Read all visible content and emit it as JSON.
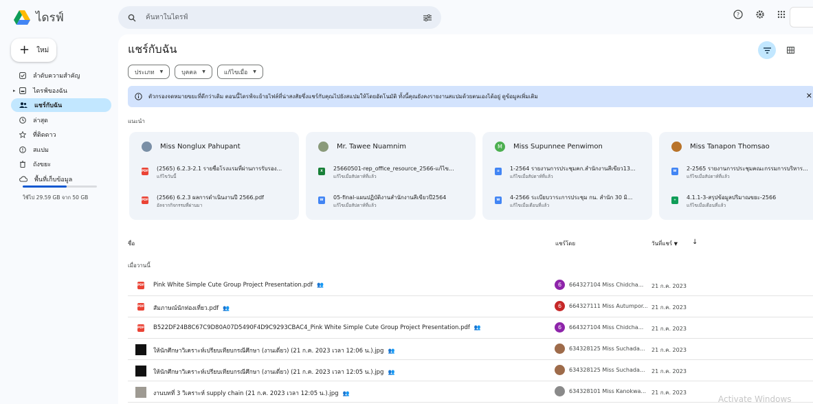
{
  "app": {
    "name": "ไดรฟ์"
  },
  "search": {
    "placeholder": "ค้นหาในไดรฟ์"
  },
  "sidebar": {
    "new_label": "ใหม่",
    "items": [
      {
        "label": "ลำดับความสำคัญ",
        "icon": "priority-icon"
      },
      {
        "label": "ไดรฟ์ของฉัน",
        "icon": "my-drive-icon"
      },
      {
        "label": "แชร์กับฉัน",
        "icon": "shared-icon",
        "active": true
      },
      {
        "label": "ล่าสุด",
        "icon": "clock-icon"
      },
      {
        "label": "ที่ติดดาว",
        "icon": "star-icon"
      },
      {
        "label": "สแปม",
        "icon": "spam-icon"
      },
      {
        "label": "ถังขยะ",
        "icon": "trash-icon"
      },
      {
        "label": "พื้นที่เก็บข้อมูล",
        "icon": "cloud-icon"
      }
    ],
    "storage_text": "ใช้ไป 29.59 GB จาก 50 GB",
    "storage_fraction": 0.59
  },
  "main": {
    "title": "แชร์กับฉัน",
    "filters": [
      "ประเภท",
      "บุคคล",
      "แก้ไขเมื่อ"
    ],
    "banner": "ตัวกรองจดหมายขยะที่ดีกว่าเดิม  ตอนนี้ไดรฟ์จะย้ายไฟล์ที่น่าสงสัยซึ่งแชร์กับคุณไปยังสแปมให้โดยอัตโนมัติ ทั้งนี้คุณยังคงรายงานสแปมด้วยตนเองได้อยู่ ดูข้อมูลเพิ่มเติม",
    "suggested_label": "แนะนำ",
    "cards": [
      {
        "person": "Miss Nonglux Pahupant",
        "avatar_color": "#7a8fa6",
        "files": [
          {
            "title": "(2565) 6.2.3-2.1 รายชื่อโรงแรมที่ผ่านการรับรอง...",
            "sub": "แก้ไขวันนี้",
            "type": "pdf"
          },
          {
            "title": "(2566) 6.2.3 ผลการดำเนินงานปี 2566.pdf",
            "sub": "อัลจากกิจกรรมที่ผ่านมา",
            "type": "pdf"
          }
        ]
      },
      {
        "person": "Mr. Tawee Nuamnim",
        "avatar_color": "#8a9a7a",
        "files": [
          {
            "title": "25660501-rep_office_resource_2566-แก้ไข...",
            "sub": "แก้ไขเมื่อสัปดาห์ที่แล้ว",
            "type": "sheet"
          },
          {
            "title": "05-final-แผนปฏิบัติงานสำนักงานสีเขียวปี2564",
            "sub": "แก้ไขเมื่อสัปดาห์ที่แล้ว",
            "type": "word"
          }
        ]
      },
      {
        "person": "Miss Supunnee Penwimon",
        "avatar_color": "#4caf50",
        "avatar_letter": "M",
        "files": [
          {
            "title": "1-2564 รายงานการประชุมคก.สำนักงานสีเขียว13...",
            "sub": "แก้ไขเมื่อสัปดาห์ที่แล้ว",
            "type": "doc"
          },
          {
            "title": "4-2566 ระเบียบวาระการประชุม กน. สำนัก 30 มิ...",
            "sub": "แก้ไขเมื่อเดือนที่แล้ว",
            "type": "word"
          }
        ]
      },
      {
        "person": "Miss Tanapon Thomsao",
        "avatar_color": "#b8732a",
        "files": [
          {
            "title": "2-2565 รายงานการประชุมคณะกรรมการบริหาร...",
            "sub": "แก้ไขเมื่อสัปดาห์ที่แล้ว",
            "type": "word"
          },
          {
            "title": "4.1.1-3-สรุปข้อมูลปริมาณขยะ-2566",
            "sub": "แก้ไขเมื่อเดือนที่แล้ว",
            "type": "sheet2"
          }
        ]
      }
    ],
    "list": {
      "col_name": "ชื่อ",
      "col_shared_by": "แชร์โดย",
      "col_date": "วันที่แชร์",
      "group_label": "เมื่อวานนี้",
      "rows": [
        {
          "name": "Pink White Simple Cute Group Project Presentation.pdf",
          "kind": "pdf",
          "sharer": "664327104 Miss Chidcha...",
          "sharer_letter": "6",
          "sharer_color": "#8e24aa",
          "date": "21 ก.ค. 2023"
        },
        {
          "name": "สัมภาษณ์นักท่องเที่ยว.pdf",
          "kind": "pdf",
          "sharer": "664327111 Miss Autumpor...",
          "sharer_letter": "6",
          "sharer_color": "#c62828",
          "date": "21 ก.ค. 2023"
        },
        {
          "name": "B522DF24B8C67C9D80A07D5490F4D9C9293CBAC4_Pink White Simple Cute Group Project Presentation.pdf",
          "kind": "pdf",
          "sharer": "664327104 Miss Chidcha...",
          "sharer_letter": "6",
          "sharer_color": "#8e24aa",
          "date": "21 ก.ค. 2023"
        },
        {
          "name": "ให้นักศึกษาวิเคราะห์เปรียบเทียบกรณีศึกษา (งานเดี่ยว) (21 ก.ค. 2023 เวลา 12:06 น.).jpg",
          "kind": "img",
          "sharer": "634328125 Miss Suchada...",
          "sharer_letter": "",
          "sharer_color": "#9e6b4a",
          "date": "21 ก.ค. 2023"
        },
        {
          "name": "ให้นักศึกษาวิเคราะห์เปรียบเทียบกรณีศึกษา (งานเดี่ยว) (21 ก.ค. 2023 เวลา 12:05 น.).jpg",
          "kind": "img",
          "sharer": "634328125 Miss Suchada...",
          "sharer_letter": "",
          "sharer_color": "#9e6b4a",
          "date": "21 ก.ค. 2023"
        },
        {
          "name": "งานบทที่ 3 วิเคราะห์ supply chain (21 ก.ค. 2023 เวลา 12:05 น.).jpg",
          "kind": "img2",
          "sharer": "634328101 Miss Kanokwa...",
          "sharer_letter": "",
          "sharer_color": "#8a8a8a",
          "date": "21 ก.ค. 2023"
        }
      ]
    }
  },
  "watermark": "Activate Windows"
}
